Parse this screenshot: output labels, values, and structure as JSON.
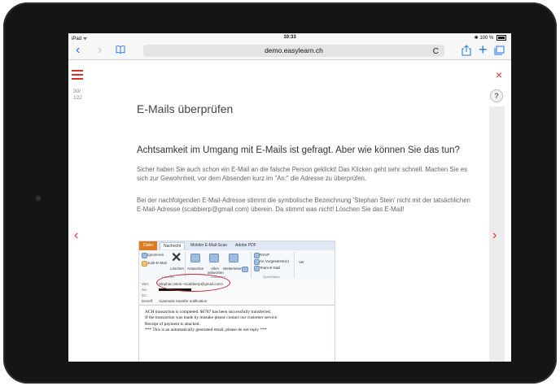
{
  "status_bar": {
    "device": "iPad",
    "wifi": "ᯤ",
    "time": "10:33",
    "bluetooth": "✱",
    "battery": "100 %"
  },
  "browser": {
    "url": "demo.easylearn.ch",
    "back": "‹",
    "forward": "›",
    "reload": "C",
    "new_tab": "+"
  },
  "page": {
    "counter_current": "30/",
    "counter_total": "122",
    "close": "×",
    "help": "?",
    "prev": "‹",
    "next": "›",
    "title": "E-Mails überprüfen",
    "subheading": "Achtsamkeit im Umgang mit E-Mails ist gefragt. Aber wie können Sie das tun?",
    "paragraph1": "Sicher haben Sie auch schon ein E-Mail an die falsche Person geklickt! Das Klicken geht sehr schnell. Machen Sie es sich zur Gewohnheit, vor dem Absenden kurz im \"An:\" die Adresse zu überprüfen.",
    "paragraph2": "Bei der nachfolgenden E-Mail-Adresse stimmt die symbolische Bezeichnung 'Stephan Stein' nicht mit der tatsächlichen E-Mail-Adresse (scabbierp@gmail.com) überein. Da stimmt was nicht! Löschen Sie das E-Mail!"
  },
  "outlook": {
    "tabs": [
      "Datei",
      "Nachricht",
      "Mobiler E-Mail-Scan",
      "Adobe PDF"
    ],
    "ribbon": {
      "ignore": "Ignorieren",
      "junk": "Junk-E-Mail",
      "delete": "Löschen",
      "reply": "Antworten",
      "reply_all": "Allen antworten",
      "forward": "Weiterleiten",
      "rsvp": "RSVP",
      "to_manager": "An Vorgesetzte(n)",
      "team_email": "Team-E-Mail",
      "move": "Ver",
      "group_delete": "Löschen",
      "group_respond": "Antworten",
      "group_quick": "QuickSteps"
    },
    "headers": {
      "from_label": "Von:",
      "from_value": "Stephan Stein <scabbierp@gmail.com>",
      "to_label": "An:",
      "cc_label": "Cc:",
      "subject_label": "Betreff:",
      "subject_value": "Automatic transfer notification"
    },
    "body": [
      "ACH transaction is completed. $6787 has been successfully transferred.",
      "If the transaction was made by mistake please contact our customer service.",
      "Receipt of payment is attached.",
      "",
      "*** This is an automatically generated email, please do not reply ***"
    ]
  },
  "colors": {
    "accent": "#d9302c",
    "link_blue": "#1a74e8",
    "device": "#151515"
  }
}
